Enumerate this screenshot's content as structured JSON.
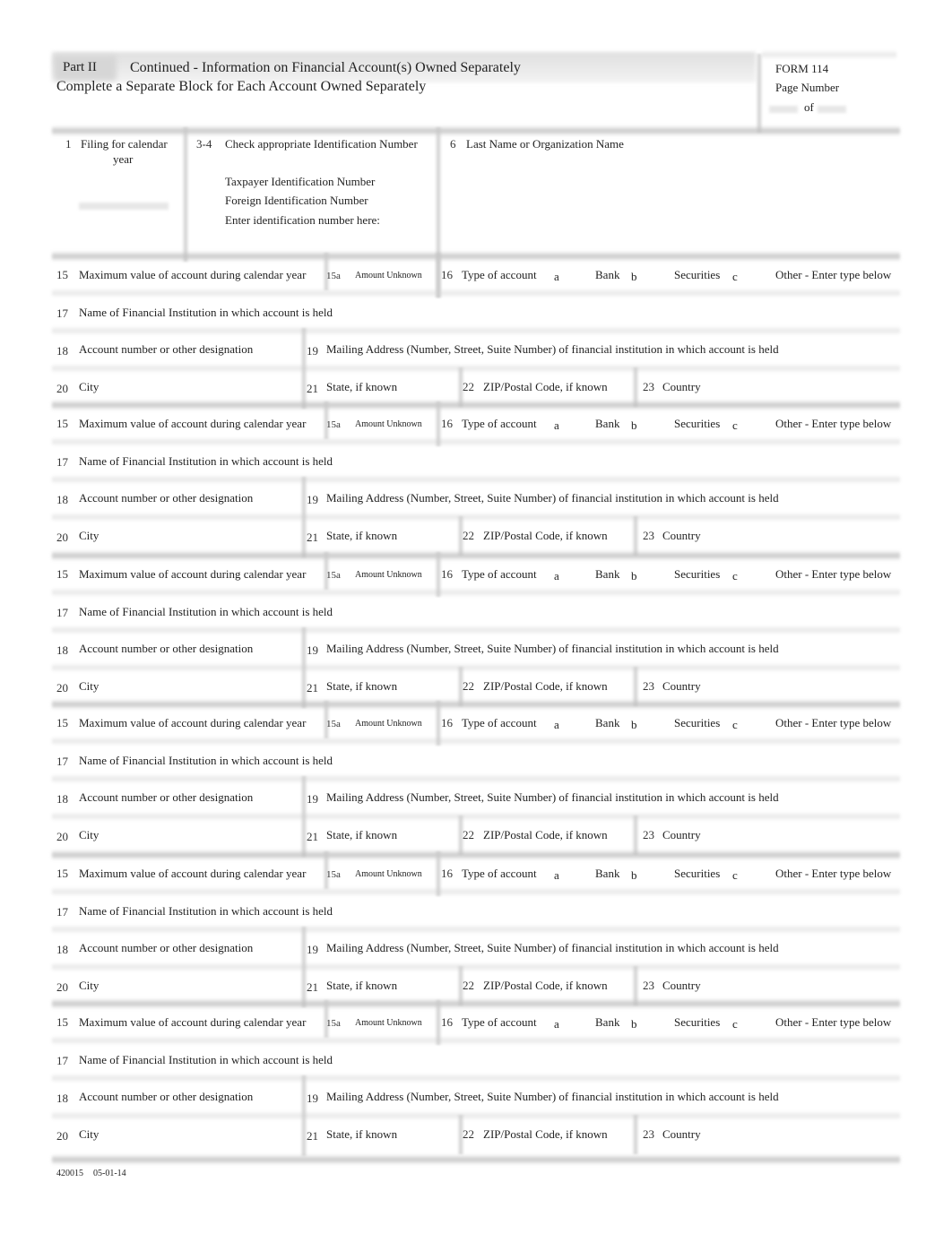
{
  "header": {
    "part_label": "Part II",
    "title": "Continued - Information on Financial Account(s) Owned Separately",
    "subtitle": "Complete a Separate Block for Each Account Owned Separately",
    "form_label": "FORM 114",
    "page_number_label": "Page Number",
    "of_label": "of"
  },
  "top_section": {
    "item1_num": "1",
    "item1_label_line1": "Filing for calendar",
    "item1_label_line2": "year",
    "item34_num": "3-4",
    "item34_label": "Check appropriate Identification Number",
    "id_option_1": "Taxpayer Identification Number",
    "id_option_2": "Foreign Identification Number",
    "id_enter_label": "Enter identification number here:",
    "item6_num": "6",
    "item6_label": "Last Name or Organization Name"
  },
  "block_labels": {
    "f15_num": "15",
    "f15_label": "Maximum value of account during calendar year",
    "f15a_num": "15a",
    "f15a_label": "Amount Unknown",
    "f16_num": "16",
    "f16_label": "Type of account",
    "f16_a": "a",
    "f16_a_label": "Bank",
    "f16_b": "b",
    "f16_b_label": "Securities",
    "f16_c": "c",
    "f16_c_label": "Other - Enter type below",
    "f17_num": "17",
    "f17_label": "Name of Financial Institution in which account is held",
    "f18_num": "18",
    "f18_label": "Account number or other designation",
    "f19_num": "19",
    "f19_label": "Mailing Address (Number, Street, Suite Number) of financial institution in which account is held",
    "f20_num": "20",
    "f20_label": "City",
    "f21_num": "21",
    "f21_label": "State, if known",
    "f22_num": "22",
    "f22_label": "ZIP/Postal Code, if known",
    "f23_num": "23",
    "f23_label": "Country"
  },
  "account_blocks": [
    {
      "index": 1
    },
    {
      "index": 2
    },
    {
      "index": 3
    },
    {
      "index": 4
    },
    {
      "index": 5
    },
    {
      "index": 6
    }
  ],
  "footer": {
    "code": "420015",
    "date": "05-01-14"
  }
}
